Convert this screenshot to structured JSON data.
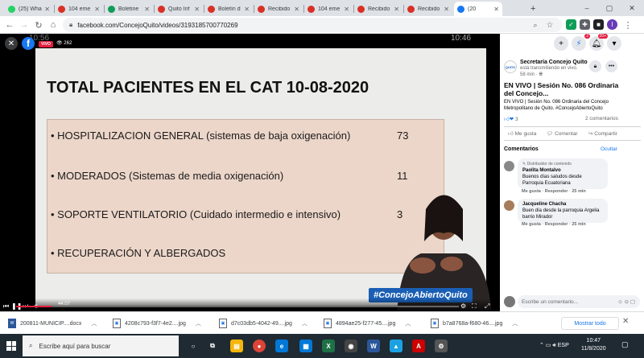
{
  "tabs": [
    {
      "title": "(25) Wha",
      "icon": "whatsapp-icon",
      "color": "#25d366"
    },
    {
      "title": "104 eme",
      "icon": "alert-icon",
      "color": "#d93025"
    },
    {
      "title": "Boletine",
      "icon": "sheets-icon",
      "color": "#0f9d58"
    },
    {
      "title": "Quito Inf",
      "icon": "alert-icon",
      "color": "#d93025"
    },
    {
      "title": "Boletín d",
      "icon": "gmail-icon",
      "color": "#d93025"
    },
    {
      "title": "Recibido",
      "icon": "gmail-icon",
      "color": "#d93025"
    },
    {
      "title": "104 eme",
      "icon": "alert-icon",
      "color": "#d93025"
    },
    {
      "title": "Recibido",
      "icon": "gmail-icon",
      "color": "#d93025"
    },
    {
      "title": "Recibido",
      "icon": "gmail-icon",
      "color": "#d93025"
    },
    {
      "title": "(20",
      "icon": "facebook-icon",
      "color": "#1877f2"
    }
  ],
  "browser": {
    "url": "facebook.com/ConcejoQuito/videos/3193185700770269",
    "new_tab": "+",
    "profile_initial": "I"
  },
  "video": {
    "time_left": "10:56",
    "time_right": "10:46",
    "live_label": "VIVO",
    "viewers": "262",
    "slide_title": "TOTAL PACIENTES EN EL CAT 10-08-2020",
    "rows": [
      {
        "text": "• HOSPITALIZACION GENERAL (sistemas de baja oxigenación)",
        "value": "73"
      },
      {
        "text": "• MODERADOS (Sistemas de media oxigenación)",
        "value": "11"
      },
      {
        "text": "• SOPORTE VENTILATORIO (Cuidado intermedio e intensivo)",
        "value": "3"
      },
      {
        "text": "• RECUPERACIÓN   Y  ALBERGADOS",
        "value": ""
      }
    ],
    "hashtag": "#ConcejoAbiertoQuito",
    "current_time": "44:07",
    "progress": 0.08
  },
  "fb_header": {
    "messenger_badge": "2",
    "notif_badge": "20+"
  },
  "panel": {
    "page_name": "Secretaría Concejo Quito",
    "page_sub": "está transmitiendo en vivo.",
    "time": "58 min · ",
    "post_title": "EN VIVO | Sesión No. 086 Ordinaria del Concejo...",
    "post_desc": "EN VIVO | Sesión No. 086 Ordinaria del Concejo Metropolitano de Quito. #ConcejoAbiertoQuito",
    "reactions": "3",
    "comment_count": "2 comentarios",
    "like": "Me gusta",
    "comment": "Comentar",
    "share": "Compartir",
    "comments_title": "Comentarios",
    "hide": "Ocultar",
    "comments": [
      {
        "tag": "Distribuidor de contenido",
        "name": "Paolita Montalvo",
        "text": "Buenos días saludos desde Parroquia Ecuatoriana",
        "meta": "Me gusta · Responder · 25 min"
      },
      {
        "tag": "",
        "name": "Jacqueline Chacha",
        "text": "Buen día desde la parroquia Argelia barrio Mirador",
        "meta": "Me gusta · Responder · 25 min"
      }
    ],
    "write_placeholder": "Escribe un comentario..."
  },
  "downloads": [
    {
      "name": "200811-MUNICIP....docx",
      "type": "W"
    },
    {
      "name": "4208c793-f3f7-4e2....jpg",
      "type": "jpg"
    },
    {
      "name": "d7c03db5-4042-49....jpg",
      "type": "jpg"
    },
    {
      "name": "4894ae25-f277-45....jpg",
      "type": "jpg"
    },
    {
      "name": "b7a8768a-f680-46....jpg",
      "type": "jpg"
    }
  ],
  "show_all": "Mostrar todo",
  "taskbar": {
    "search_placeholder": "Escribe aquí para buscar",
    "lang": "ESP",
    "time": "10:47",
    "date": "11/8/2020"
  }
}
